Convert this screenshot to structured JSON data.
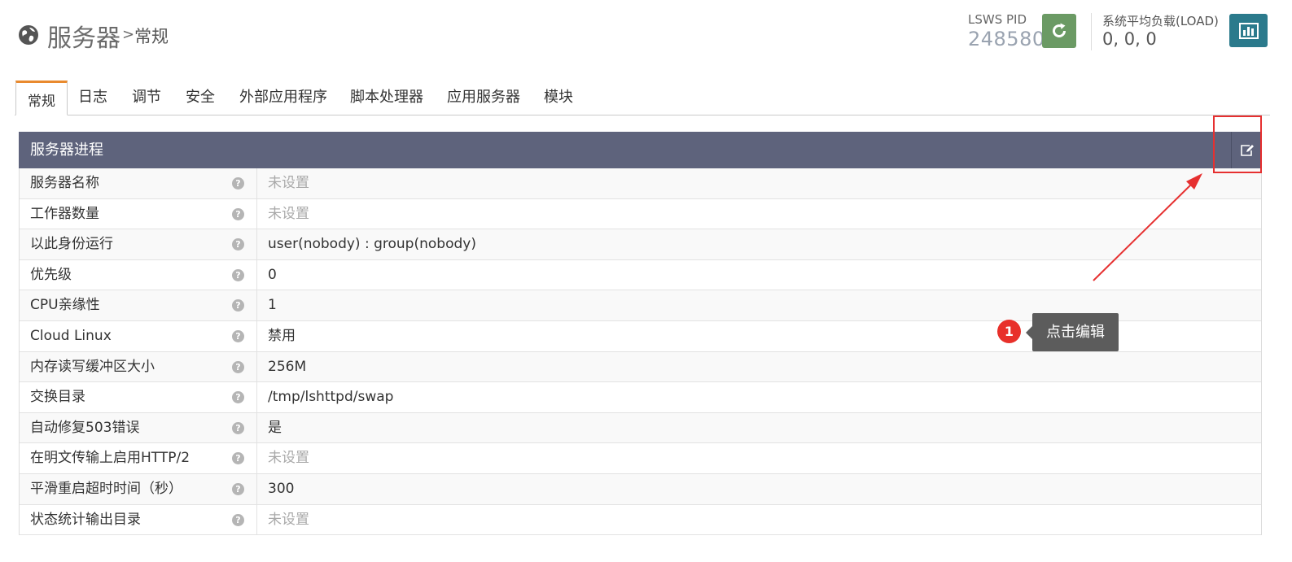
{
  "header": {
    "title": "服务器",
    "crumb_separator": ">",
    "crumb": "常规",
    "pid_label": "LSWS PID",
    "pid_value": "248580",
    "load_label": "系统平均负载(LOAD)",
    "load_value": "0, 0, 0",
    "restart_icon": "refresh-icon",
    "stats_icon": "bar-chart-icon",
    "colors": {
      "restart": "#6b9a64",
      "stats": "#2b7a8c"
    }
  },
  "tabs": [
    {
      "label": "常规",
      "active": true
    },
    {
      "label": "日志"
    },
    {
      "label": "调节"
    },
    {
      "label": "安全"
    },
    {
      "label": "外部应用程序"
    },
    {
      "label": "脚本处理器"
    },
    {
      "label": "应用服务器"
    },
    {
      "label": "模块"
    }
  ],
  "panel": {
    "title": "服务器进程",
    "edit_icon": "edit-icon",
    "header_color": "#5e637c",
    "rows": [
      {
        "label": "服务器名称",
        "value": "未设置",
        "unset": true
      },
      {
        "label": "工作器数量",
        "value": "未设置",
        "unset": true
      },
      {
        "label": "以此身份运行",
        "value": "user(nobody) : group(nobody)"
      },
      {
        "label": "优先级",
        "value": "0"
      },
      {
        "label": "CPU亲缘性",
        "value": "1"
      },
      {
        "label": "Cloud Linux",
        "value": "禁用"
      },
      {
        "label": "内存读写缓冲区大小",
        "value": "256M"
      },
      {
        "label": "交换目录",
        "value": "/tmp/lshttpd/swap"
      },
      {
        "label": "自动修复503错误",
        "value": "是"
      },
      {
        "label": "在明文传输上启用HTTP/2",
        "value": "未设置",
        "unset": true
      },
      {
        "label": "平滑重启超时时间（秒）",
        "value": "300"
      },
      {
        "label": "状态统计输出目录",
        "value": "未设置",
        "unset": true
      }
    ]
  },
  "annotation": {
    "badge": "1",
    "tooltip": "点击编辑",
    "color": "#e63030"
  }
}
